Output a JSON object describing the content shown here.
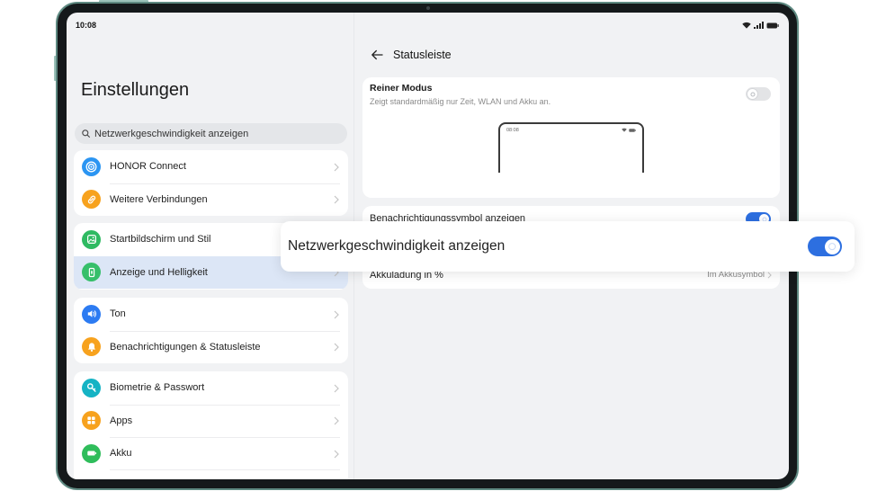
{
  "status_bar": {
    "time": "10:08",
    "icons": [
      "wifi-icon",
      "signal-icon",
      "battery-icon"
    ]
  },
  "sidebar": {
    "title": "Einstellungen",
    "search": {
      "value": "Netzwerkgeschwindigkeit anzeigen",
      "icon": "search-icon"
    },
    "groups": [
      {
        "items": [
          {
            "label": "HONOR Connect",
            "icon": "honor-connect-icon",
            "color": "#2b95f2"
          },
          {
            "label": "Weitere Verbindungen",
            "icon": "link-icon",
            "color": "#f7a21e"
          }
        ]
      },
      {
        "items": [
          {
            "label": "Startbildschirm und Stil",
            "icon": "wallpaper-icon",
            "color": "#2fba62"
          },
          {
            "label": "Anzeige und Helligkeit",
            "icon": "display-icon",
            "color": "#36bf6a",
            "selected": true
          }
        ]
      },
      {
        "items": [
          {
            "label": "Ton",
            "icon": "speaker-icon",
            "color": "#2c7bf2"
          },
          {
            "label": "Benachrichtigungen & Statusleiste",
            "icon": "bell-icon",
            "color": "#f7a21e"
          }
        ]
      },
      {
        "items": [
          {
            "label": "Biometrie & Passwort",
            "icon": "key-icon",
            "color": "#15b3c4"
          },
          {
            "label": "Apps",
            "icon": "apps-icon",
            "color": "#f7a21e"
          },
          {
            "label": "Akku",
            "icon": "battery-icon",
            "color": "#2fbd5b"
          }
        ]
      }
    ]
  },
  "detail": {
    "title": "Statusleiste",
    "back_icon": "back-arrow-icon",
    "pure_mode": {
      "title": "Reiner Modus",
      "description": "Zeigt standardmäßig nur Zeit, WLAN und Akku an.",
      "enabled": false,
      "preview_time": "08:08"
    },
    "notification_icons": {
      "label": "Benachrichtigungssymbol anzeigen",
      "enabled": true
    },
    "battery_percent": {
      "label": "Akkuladung in %",
      "value": "Im Akkusymbol"
    }
  },
  "callout": {
    "label": "Netzwerkgeschwindigkeit anzeigen",
    "enabled": true
  },
  "colors": {
    "accent": "#2d6fe0",
    "selected_row": "#dce6f6",
    "background": "#f1f2f4",
    "card": "#ffffff"
  }
}
